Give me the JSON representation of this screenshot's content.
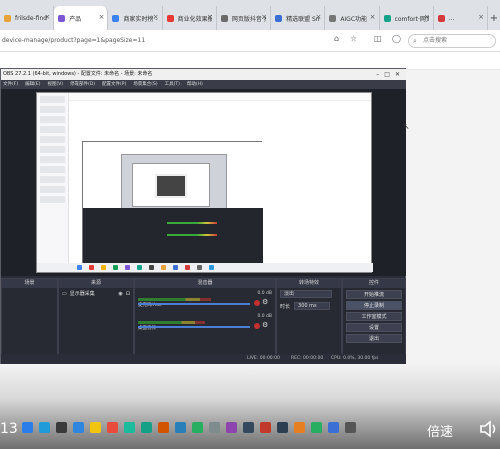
{
  "browser": {
    "tabs": [
      {
        "title": "frilsde-find",
        "color": "#e8a23a",
        "active": false
      },
      {
        "title": "产品",
        "color": "#7b57d4",
        "active": true
      },
      {
        "title": "商家实时榜 - 跨境...",
        "color": "#3b82f6",
        "active": false
      },
      {
        "title": "商业化效果报表",
        "color": "#e53935",
        "active": false
      },
      {
        "title": "网页版抖音·抖音...",
        "color": "#6b6b6b",
        "active": false
      },
      {
        "title": "精选联盟 Smart...",
        "color": "#3b6fd6",
        "active": false
      },
      {
        "title": "AIGC功能",
        "color": "#777777",
        "active": false
      },
      {
        "title": "comfort·网页版...",
        "color": "#13a38a",
        "active": false
      },
      {
        "title": "...",
        "color": "#d43a3a",
        "active": false
      }
    ],
    "url": "device-manage/product?page=1&pageSize=11",
    "search_placeholder": "点击搜索"
  },
  "obs": {
    "title": "OBS 27.2.1 (64-bit, windows) - 配置文件: 未命名 - 场景: 未命名",
    "menu": [
      "文件(F)",
      "编辑(E)",
      "视图(V)",
      "停靠部件(D)",
      "配置文件(P)",
      "场景集合(S)",
      "工具(T)",
      "帮助(H)"
    ],
    "docks": {
      "scenes_label": "场景",
      "sources_label": "来源",
      "mixer_label": "混音器",
      "transitions_label": "转场特效",
      "controls_label": "控件"
    },
    "sources": [
      {
        "name": "显示器采集"
      }
    ],
    "mixer": [
      {
        "name": "麦克风/Aux",
        "db": "0.0 dB",
        "level": 0.65
      },
      {
        "name": "桌面音频",
        "db": "0.0 dB",
        "level": 0.6
      }
    ],
    "transition": {
      "type": "淡出",
      "duration_label": "时长",
      "duration": "300 ms"
    },
    "controls": [
      "开始推流",
      "停止录制",
      "工作室模式",
      "设置",
      "退出"
    ],
    "status": {
      "live": "LIVE: 00:00:00",
      "rec": "REC: 00:00:00",
      "cpu": "CPU: 0.0%, 30.00 fps"
    }
  },
  "player": {
    "timecode": "13",
    "speed_label": "倍速"
  },
  "icons": {
    "volume": "speaker-icon",
    "search": "search-icon"
  }
}
